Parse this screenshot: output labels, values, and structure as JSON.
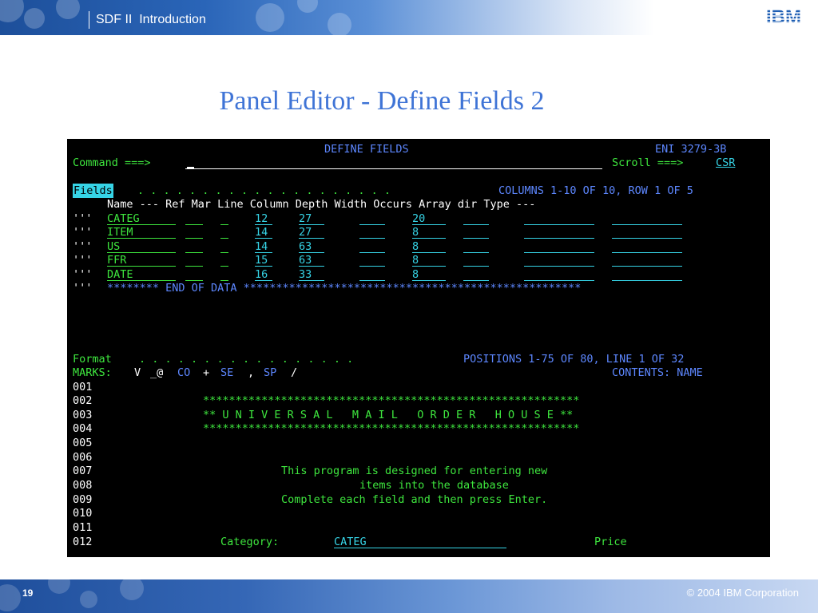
{
  "header": {
    "title": "SDF II  Introduction",
    "logo": "IBM"
  },
  "slide": {
    "title": "Panel Editor - Define Fields 2"
  },
  "terminal": {
    "title": "DEFINE FIELDS",
    "terminal_id": "ENI 3279-3B",
    "command_label": "Command ===>",
    "command_value": "",
    "scroll_label": "Scroll ===>",
    "scroll_value": "CSR",
    "fields_label": "Fields",
    "fields_dots": ". . . . . . . . . . . . . . . . . . . .",
    "fields_position": "COLUMNS 1-10 OF 10, ROW 1 OF 5",
    "columns_header": "Name --- Ref Mar Line Column Depth Width Occurs Array dir Type ---",
    "rows": [
      {
        "prefix": "'''",
        "name": "CATEG",
        "ref": "",
        "mar": "",
        "line": "12",
        "column": "27",
        "depth": "",
        "width": "20",
        "occurs": "",
        "array_dir": "",
        "type": ""
      },
      {
        "prefix": "'''",
        "name": "ITEM",
        "ref": "",
        "mar": "",
        "line": "14",
        "column": "27",
        "depth": "",
        "width": "8",
        "occurs": "",
        "array_dir": "",
        "type": ""
      },
      {
        "prefix": "'''",
        "name": "US",
        "ref": "",
        "mar": "",
        "line": "14",
        "column": "63",
        "depth": "",
        "width": "8",
        "occurs": "",
        "array_dir": "",
        "type": ""
      },
      {
        "prefix": "'''",
        "name": "FFR",
        "ref": "",
        "mar": "",
        "line": "15",
        "column": "63",
        "depth": "",
        "width": "8",
        "occurs": "",
        "array_dir": "",
        "type": ""
      },
      {
        "prefix": "'''",
        "name": "DATE",
        "ref": "",
        "mar": "",
        "line": "16",
        "column": "33",
        "depth": "",
        "width": "8",
        "occurs": "",
        "array_dir": "",
        "type": ""
      }
    ],
    "end_prefix": "'''",
    "end_of_data": "******** END OF DATA ****************************************************",
    "format_label": "Format",
    "format_dots": ". . . . . . . . . . . . . . . . .",
    "format_position": "POSITIONS 1-75 OF 80, LINE 1 OF 32",
    "marks_label": "MARKS:",
    "marks": [
      "V",
      "_@",
      "CO",
      "+",
      "SE",
      ",",
      "SP",
      "/"
    ],
    "contents_label": "CONTENTS: NAME",
    "lines": [
      {
        "num": "001",
        "text": ""
      },
      {
        "num": "002",
        "text": "**********************************************************"
      },
      {
        "num": "003",
        "text": "** U N I V E R S A L   M A I L   O R D E R   H O U S E **"
      },
      {
        "num": "004",
        "text": "**********************************************************"
      },
      {
        "num": "005",
        "text": ""
      },
      {
        "num": "006",
        "text": ""
      },
      {
        "num": "007",
        "text": "This program is designed for entering new"
      },
      {
        "num": "008",
        "text": "items into the database"
      },
      {
        "num": "009",
        "text": "Complete each field and then press Enter."
      },
      {
        "num": "010",
        "text": ""
      },
      {
        "num": "011",
        "text": ""
      },
      {
        "num": "012",
        "text": ""
      }
    ],
    "line12": {
      "category_label": "Category:",
      "category_value": "CATEG",
      "price_label": "Price"
    }
  },
  "footer": {
    "page_number": "19",
    "copyright": "© 2004 IBM Corporation"
  },
  "colors": {
    "title_blue": "#3f74d6",
    "terminal_bg": "#000000",
    "term_blue": "#5d87ff",
    "term_green": "#3ee63e",
    "term_turquoise": "#36d4e6"
  }
}
